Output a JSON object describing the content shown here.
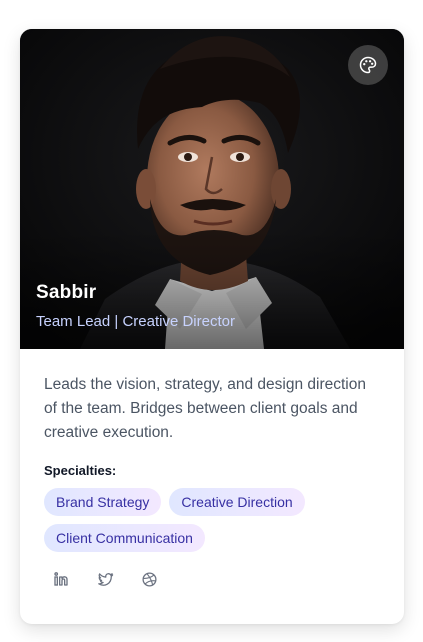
{
  "profile": {
    "name": "Sabbir",
    "role": "Team Lead | Creative Director",
    "description": "Leads the vision, strategy, and design direction of the team. Bridges between client goals and creative execution.",
    "specialties_title": "Specialties:",
    "specialties": [
      "Brand Strategy",
      "Creative Direction",
      "Client Communication"
    ],
    "theme_button_icon": "palette-icon",
    "socials": [
      {
        "icon": "linkedin-icon"
      },
      {
        "icon": "twitter-icon"
      },
      {
        "icon": "dribbble-icon"
      }
    ]
  },
  "colors": {
    "name_text": "#ffffff",
    "role_text": "#c7d2fe",
    "tag_text": "#3730a3",
    "tag_bg_start": "#e0e7ff",
    "tag_bg_end": "#f3e8ff",
    "description_text": "#4b5563",
    "icon_color": "#6b7280"
  }
}
